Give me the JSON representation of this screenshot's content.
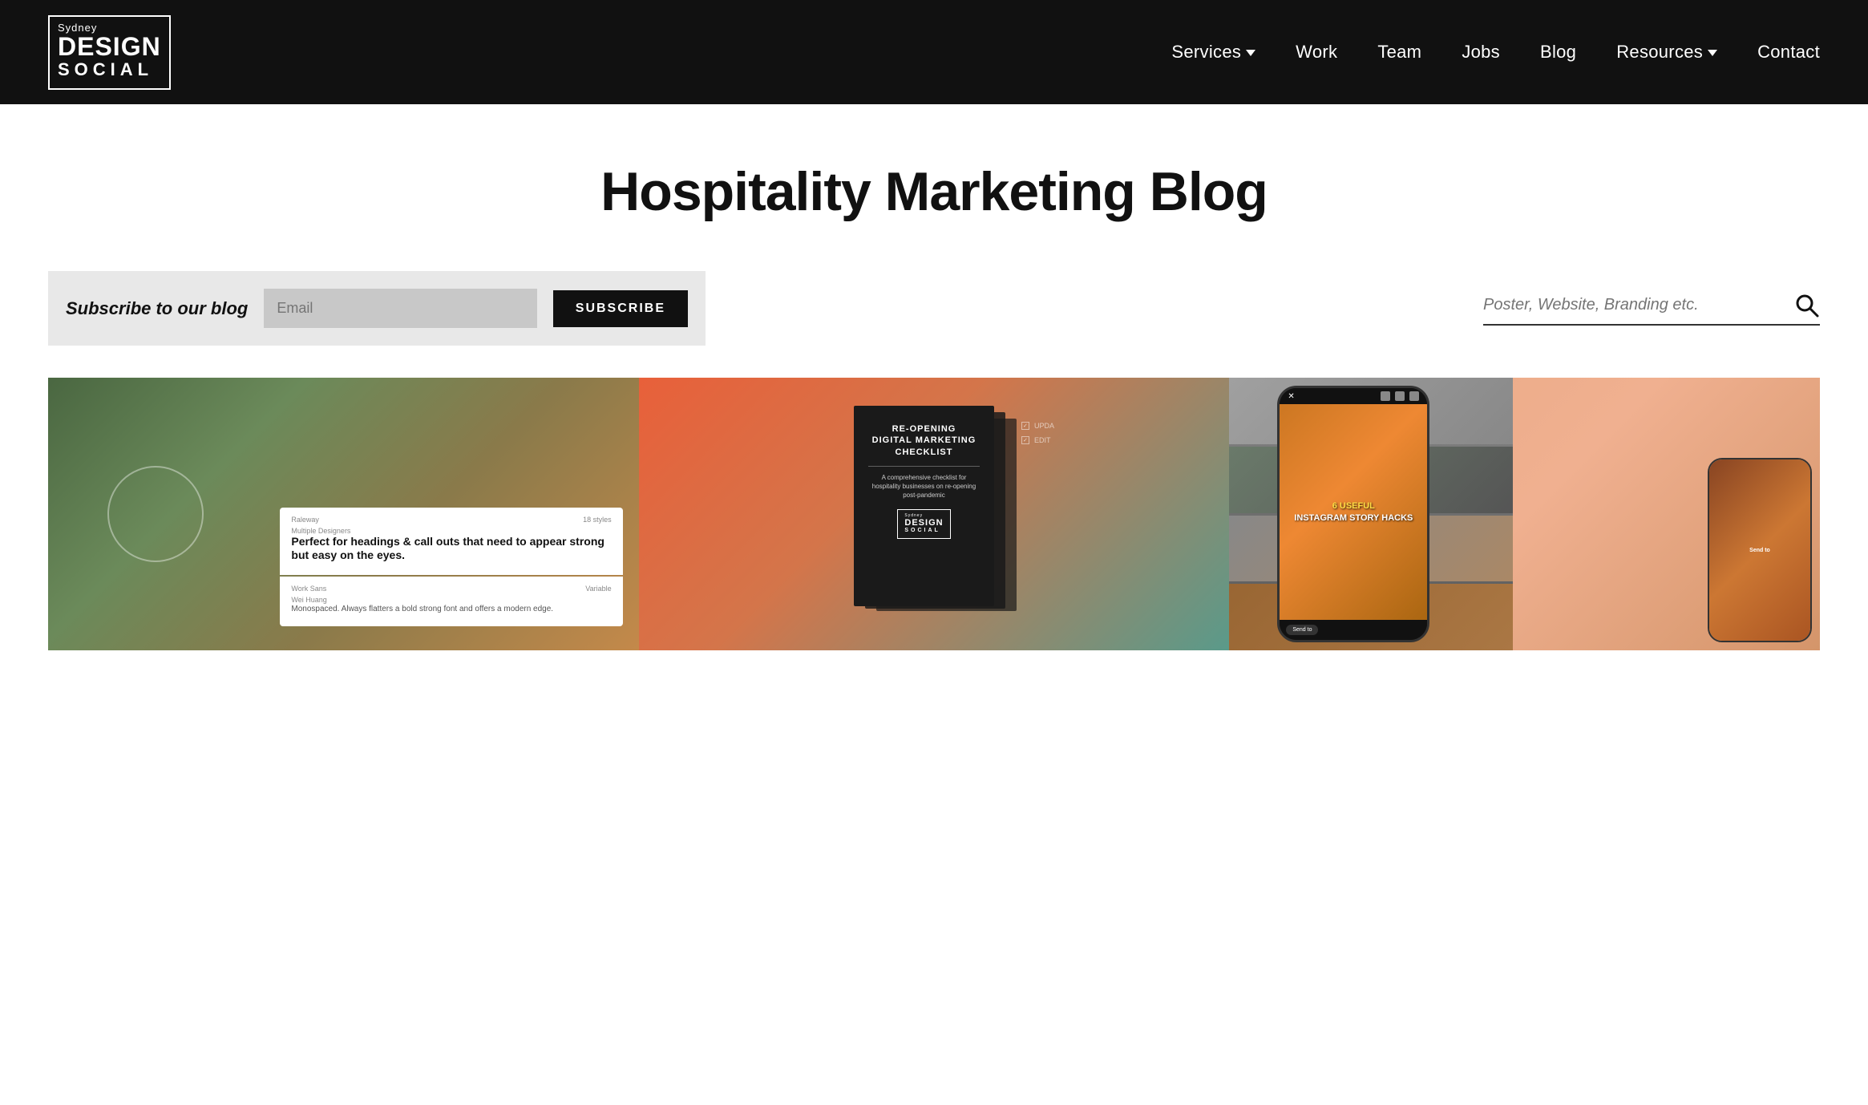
{
  "site": {
    "logo": {
      "sydney": "Sydney",
      "design": "DESIGN",
      "social": "SOCIAL"
    }
  },
  "navbar": {
    "links": [
      {
        "label": "Services",
        "hasDropdown": true
      },
      {
        "label": "Work",
        "hasDropdown": false
      },
      {
        "label": "Team",
        "hasDropdown": false
      },
      {
        "label": "Jobs",
        "hasDropdown": false
      },
      {
        "label": "Blog",
        "hasDropdown": false
      },
      {
        "label": "Resources",
        "hasDropdown": true
      },
      {
        "label": "Contact",
        "hasDropdown": false
      }
    ]
  },
  "hero": {
    "title": "Hospitality Marketing Blog"
  },
  "subscribe": {
    "label": "Subscribe to our blog",
    "input_placeholder": "Email",
    "button_label": "SUBSCRIBE"
  },
  "search": {
    "placeholder": "Poster, Website, Branding etc."
  },
  "cards": [
    {
      "id": "card-fonts",
      "font_name": "Raleway",
      "font_styles": "18 styles",
      "font_designer": "Multiple Designers",
      "font_headline": "Perfect for headings & call outs that need to appear strong but easy on the eyes.",
      "font2_name": "Work Sans",
      "font2_variant": "Variable",
      "font2_designer": "Wei Huang",
      "font2_desc": "Monospaced. Always flatters a bold strong font and offers a modern edge."
    },
    {
      "id": "card-checklist",
      "title_line1": "RE-OPENING",
      "title_line2": "DIGITAL MARKETING",
      "title_line3": "CHECKLIST",
      "description": "A comprehensive checklist for hospitality businesses on re-opening post-pandemic",
      "logo_sydney": "Sydney",
      "logo_design": "DESIGN",
      "logo_social": "SOCIAL",
      "sidebar_items": [
        "UPDA",
        "EDIT"
      ]
    },
    {
      "id": "card-instagram",
      "overlay_text_yellow": "6 USEFUL",
      "overlay_text_white": "INSTAGRAM STORY HACKS"
    }
  ]
}
